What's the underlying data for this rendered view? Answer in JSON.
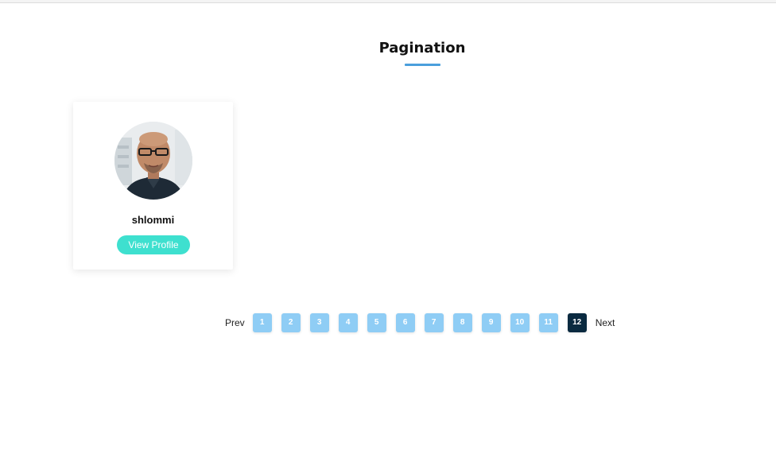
{
  "header": {
    "title": "Pagination"
  },
  "card": {
    "name": "shlommi",
    "button_label": "View Profile"
  },
  "pagination": {
    "prev_label": "Prev",
    "next_label": "Next",
    "pages": [
      "1",
      "2",
      "3",
      "4",
      "5",
      "6",
      "7",
      "8",
      "9",
      "10",
      "11",
      "12"
    ],
    "active_page": "12"
  },
  "colors": {
    "accent_underline": "#4a9fdc",
    "button_bg": "#3ee0cf",
    "page_bg": "#8fcdf5",
    "page_active_bg": "#0a2a40"
  }
}
